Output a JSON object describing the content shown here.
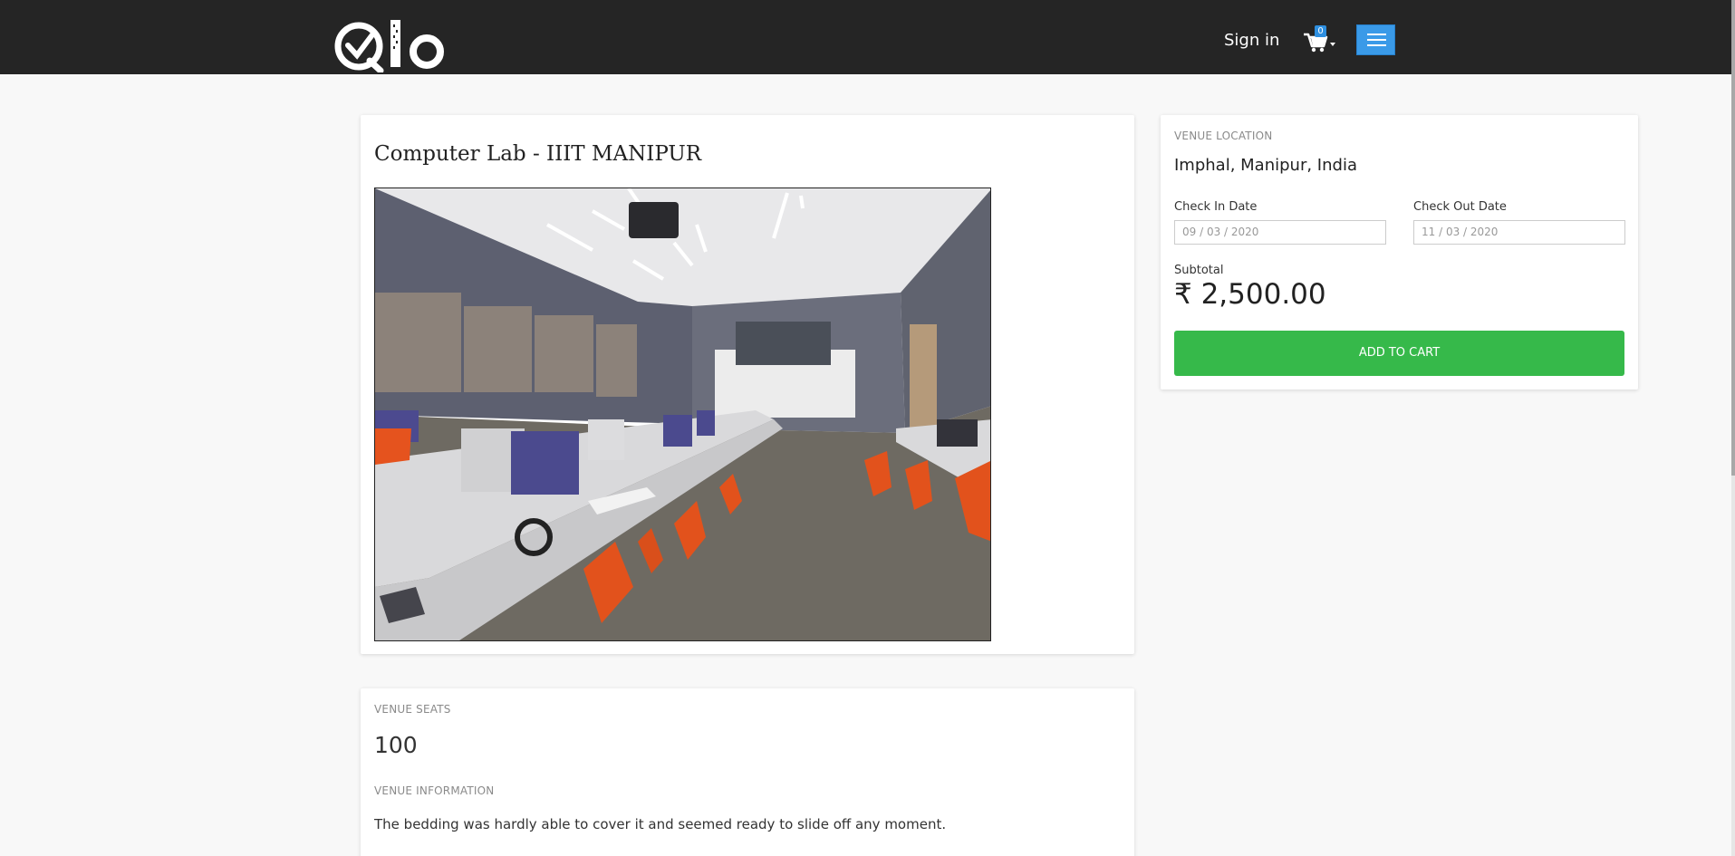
{
  "header": {
    "logo_text": "Qlo",
    "signin_label": "Sign in",
    "cart_count": "0",
    "colors": {
      "bar": "#252525",
      "menu_button": "#3a9ae8",
      "badge": "#2e8fe0"
    }
  },
  "venue": {
    "title": "Computer Lab - IIIT MANIPUR",
    "image": "computer-lab-photo"
  },
  "booking": {
    "location_label": "VENUE LOCATION",
    "location_value": "Imphal, Manipur, India",
    "checkin_label": "Check In Date",
    "checkin_value": "09 / 03 / 2020",
    "checkout_label": "Check Out Date",
    "checkout_value": "11 / 03 / 2020",
    "subtotal_label": "Subtotal",
    "subtotal_value": "₹ 2,500.00",
    "add_button_label": "ADD TO CART",
    "accent_color": "#36b94a"
  },
  "details": {
    "seats_label": "VENUE SEATS",
    "seats_value": "100",
    "info_label": "VENUE INFORMATION",
    "info_text": "The bedding was hardly able to cover it and seemed ready to slide off any moment."
  }
}
